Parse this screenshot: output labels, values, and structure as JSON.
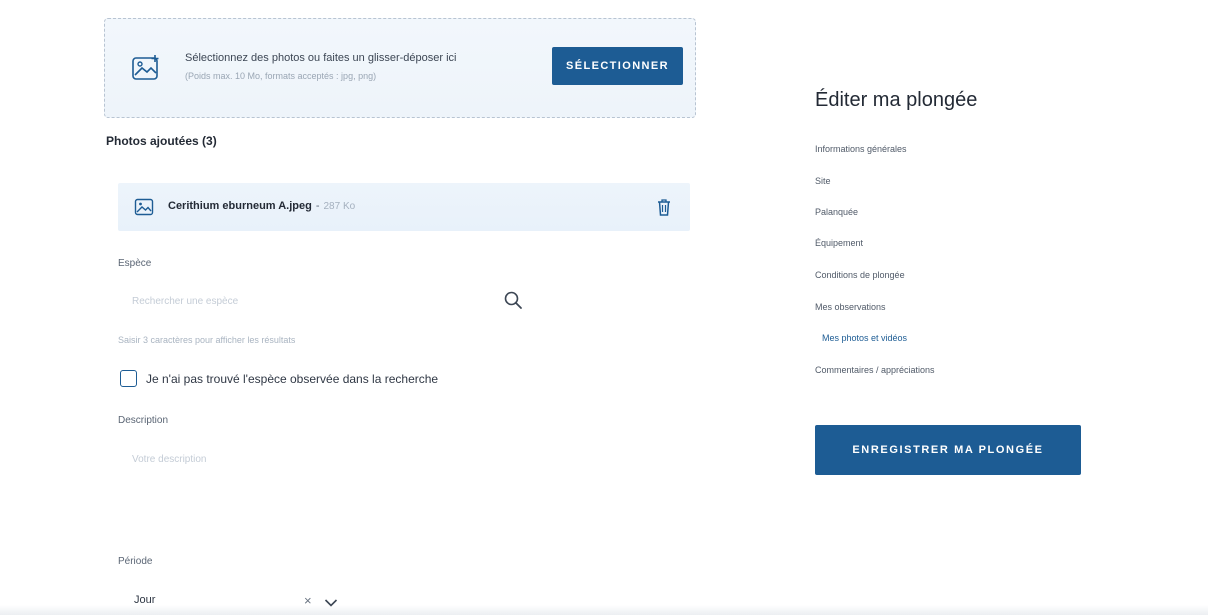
{
  "upload": {
    "instruction": "Sélectionnez des photos ou faites un glisser-déposer ici",
    "subtext": "(Poids max. 10 Mo, formats acceptés : jpg, png)",
    "select_label": "SÉLECTIONNER"
  },
  "photos": {
    "title": "Photos ajoutées (3)",
    "items": [
      {
        "name": "Cerithium eburneum A.jpeg",
        "separator": "-",
        "size": "287 Ko"
      }
    ]
  },
  "form": {
    "species_label": "Espèce",
    "species_placeholder": "Rechercher une espèce",
    "species_hint": "Saisir 3 caractères pour afficher les résultats",
    "not_found_label": "Je n'ai pas trouvé l'espèce observée dans la recherche",
    "description_label": "Description",
    "description_placeholder": "Votre description",
    "period_label": "Période",
    "period_value": "Jour",
    "clear_symbol": "×"
  },
  "sidebar": {
    "title": "Éditer ma plongée",
    "items": [
      {
        "label": "Informations générales"
      },
      {
        "label": "Site"
      },
      {
        "label": "Palanquée"
      },
      {
        "label": "Équipement"
      },
      {
        "label": "Conditions de plongée"
      },
      {
        "label": "Mes observations"
      },
      {
        "label": "Mes photos et vidéos"
      },
      {
        "label": "Commentaires / appréciations"
      }
    ],
    "active_index": 6,
    "save_label": "ENREGISTRER MA PLONGÉE"
  },
  "colors": {
    "accent": "#1d5c94",
    "dropzone_bg": "#eef4fa",
    "text": "#2a2f3a"
  },
  "icons": {
    "upload": "image-upload-icon",
    "photo": "image-icon",
    "delete": "trash-icon",
    "search": "search-icon",
    "clear": "close-icon",
    "dropdown": "chevron-down-icon"
  }
}
